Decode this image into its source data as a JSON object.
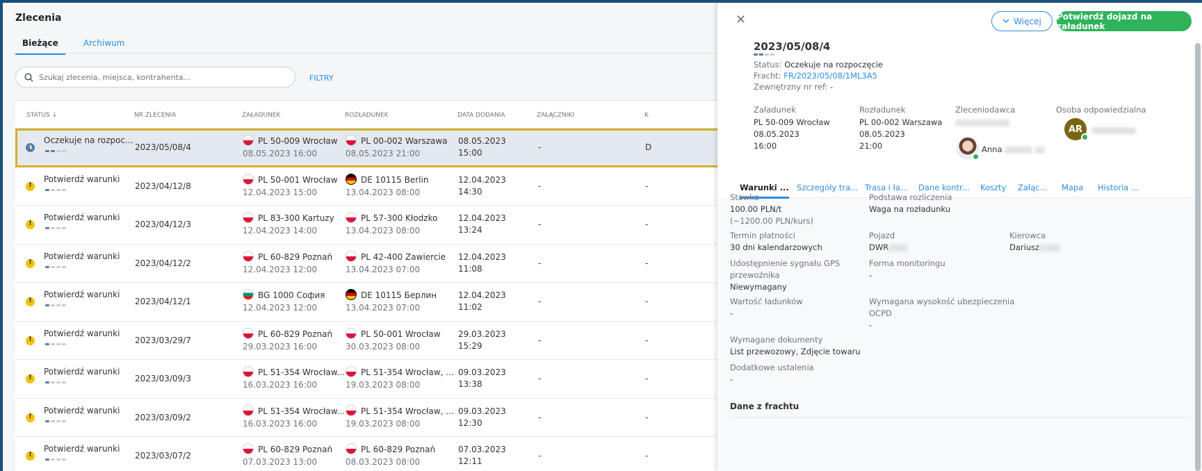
{
  "page": {
    "title": "Zlecenia"
  },
  "tabs": [
    {
      "label": "Bieżące",
      "active": true
    },
    {
      "label": "Archiwum",
      "active": false
    }
  ],
  "search": {
    "placeholder": "Szukaj zlecenia, miejsca, kontrahenta...",
    "value": ""
  },
  "filters_label": "FILTRY",
  "columns": {
    "status": "STATUS",
    "order_no": "NR ZLECENIA",
    "loading": "ZAŁADUNEK",
    "unloading": "ROZŁADUNEK",
    "date_added": "DATA DODANIA",
    "attachments": "ZAŁĄCZNIKI",
    "extra": "K"
  },
  "rows": [
    {
      "status": "Oczekuje na rozpoc...",
      "icon": "clock-icon",
      "order_no": "2023/05/08/4",
      "load_flag": "pl",
      "load_place": "PL 50-009 Wrocław",
      "load_time": "08.05.2023 16:00",
      "unload_flag": "pl",
      "unload_place": "PL 00-002 Warszawa",
      "unload_time": "08.05.2023 21:00",
      "added_date": "08.05.2023",
      "added_time": "15:00",
      "attachments": "-",
      "extra": "D",
      "selected": true,
      "progress": 2
    },
    {
      "status": "Potwierdź warunki",
      "icon": "warning-icon",
      "order_no": "2023/04/12/8",
      "load_flag": "pl",
      "load_place": "PL 50-001 Wrocław",
      "load_time": "12.04.2023 15:00",
      "unload_flag": "de",
      "unload_place": "DE 10115 Berlin",
      "unload_time": "13.04.2023 08:00",
      "added_date": "12.04.2023",
      "added_time": "14:30",
      "attachments": "-",
      "extra": "-",
      "selected": false,
      "progress": 1
    },
    {
      "status": "Potwierdź warunki",
      "icon": "warning-icon",
      "order_no": "2023/04/12/3",
      "load_flag": "pl",
      "load_place": "PL 83-300 Kartuzy",
      "load_time": "12.04.2023 14:00",
      "unload_flag": "pl",
      "unload_place": "PL 57-300 Kłodzko",
      "unload_time": "13.04.2023 08:00",
      "added_date": "12.04.2023",
      "added_time": "13:24",
      "attachments": "-",
      "extra": "-",
      "selected": false,
      "progress": 1
    },
    {
      "status": "Potwierdź warunki",
      "icon": "warning-icon",
      "order_no": "2023/04/12/2",
      "load_flag": "pl",
      "load_place": "PL 60-829 Poznań",
      "load_time": "12.04.2023 12:00",
      "unload_flag": "pl",
      "unload_place": "PL 42-400 Zawiercie",
      "unload_time": "13.04.2023 07:00",
      "added_date": "12.04.2023",
      "added_time": "11:08",
      "attachments": "-",
      "extra": "-",
      "selected": false,
      "progress": 1
    },
    {
      "status": "Potwierdź warunki",
      "icon": "warning-icon",
      "order_no": "2023/04/12/1",
      "load_flag": "bg",
      "load_place": "BG 1000 София",
      "load_time": "12.04.2023 12:00",
      "unload_flag": "de",
      "unload_place": "DE 10115 Берлин",
      "unload_time": "13.04.2023 07:00",
      "added_date": "12.04.2023",
      "added_time": "11:02",
      "attachments": "-",
      "extra": "-",
      "selected": false,
      "progress": 1
    },
    {
      "status": "Potwierdź warunki",
      "icon": "warning-icon",
      "order_no": "2023/03/29/7",
      "load_flag": "pl",
      "load_place": "PL 60-829 Poznań",
      "load_time": "29.03.2023 16:00",
      "unload_flag": "pl",
      "unload_place": "PL 50-001 Wrocław",
      "unload_time": "30.03.2023 08:00",
      "added_date": "29.03.2023",
      "added_time": "15:29",
      "attachments": "-",
      "extra": "-",
      "selected": false,
      "progress": 1
    },
    {
      "status": "Potwierdź warunki",
      "icon": "warning-icon",
      "order_no": "2023/03/09/3",
      "load_flag": "pl",
      "load_place": "PL 51-354 Wrocław...",
      "load_time": "16.03.2023 16:00",
      "unload_flag": "pl",
      "unload_place": "PL 51-354 Wrocław, ...",
      "unload_time": "19.03.2023 08:00",
      "added_date": "09.03.2023",
      "added_time": "13:38",
      "attachments": "-",
      "extra": "-",
      "selected": false,
      "progress": 1
    },
    {
      "status": "Potwierdź warunki",
      "icon": "warning-icon",
      "order_no": "2023/03/09/2",
      "load_flag": "pl",
      "load_place": "PL 51-354 Wrocław...",
      "load_time": "16.03.2023 16:00",
      "unload_flag": "pl",
      "unload_place": "PL 51-354 Wrocław, ...",
      "unload_time": "19.03.2023 08:00",
      "added_date": "09.03.2023",
      "added_time": "12:30",
      "attachments": "-",
      "extra": "-",
      "selected": false,
      "progress": 1
    },
    {
      "status": "Potwierdź warunki",
      "icon": "warning-icon",
      "order_no": "2023/03/07/2",
      "load_flag": "pl",
      "load_place": "PL 60-829 Poznań",
      "load_time": "07.03.2023 13:00",
      "unload_flag": "pl",
      "unload_place": "PL 60-829 Poznań",
      "unload_time": "08.03.2023 08:00",
      "added_date": "07.03.2023",
      "added_time": "12:11",
      "attachments": "-",
      "extra": "-",
      "selected": false,
      "progress": 1
    }
  ],
  "panel": {
    "more_label": "Więcej",
    "confirm_label": "Potwierdź dojazd na załadunek",
    "order_no": "2023/05/08/4",
    "status_label": "Status:",
    "status_value": "Oczekuje na rozpoczęcie",
    "freight_label": "Fracht:",
    "freight_value": "FR/2023/05/08/1ML3A5",
    "extref_label": "Zewnętrzny nr ref:",
    "extref_value": "-",
    "loading": {
      "label": "Załadunek",
      "place": "PL 50-009 Wrocław",
      "date": "08.05.2023",
      "time": "16:00"
    },
    "unloading": {
      "label": "Rozładunek",
      "place": "PL 00-002 Warszawa",
      "date": "08.05.2023",
      "time": "21:00"
    },
    "client": {
      "label": "Zleceniodawca",
      "contact": "Anna"
    },
    "responsible": {
      "label": "Osoba odpowiedzialna",
      "initials": "AR"
    },
    "detail_tabs": [
      "Warunki ...",
      "Szczegóły tra...",
      "Trasa i ła...",
      "Dane kontr...",
      "Koszty",
      "Załąc...",
      "Mapa",
      "Historia ..."
    ],
    "fields": {
      "rate_label": "Stawka",
      "rate_value": "100.00 PLN/t",
      "rate_sub": "(~1200.00 PLN/kurs)",
      "basis_label": "Podstawa rozliczenia",
      "basis_value": "Waga na rozładunku",
      "payment_label": "Termin płatności",
      "payment_value": "30 dni kalendarzowych",
      "vehicle_label": "Pojazd",
      "vehicle_value": "DWR",
      "driver_label": "Kierowca",
      "driver_value": "Dariusz",
      "gps_label_1": "Udostępnienie sygnału GPS",
      "gps_label_2": "przewoźnika",
      "gps_value": "Niewymagany",
      "monitor_label": "Forma monitoringu",
      "monitor_value": "-",
      "cargo_label": "Wartość ładunków",
      "cargo_value": "-",
      "insurance_label_1": "Wymagana wysokość ubezpieczenia",
      "insurance_label_2": "OCPD",
      "insurance_value": "-",
      "docs_label": "Wymagane dokumenty",
      "docs_value": "List przewozowy, Zdjęcie towaru",
      "extra_label": "Dodatkowe ustalenia",
      "extra_value": "-"
    },
    "section_title": "Dane z frachtu"
  },
  "colors": {
    "accent": "#2d8ce0",
    "confirm": "#2fb35a",
    "warning": "#f2c20a",
    "selected_outline": "#d4b02c"
  }
}
